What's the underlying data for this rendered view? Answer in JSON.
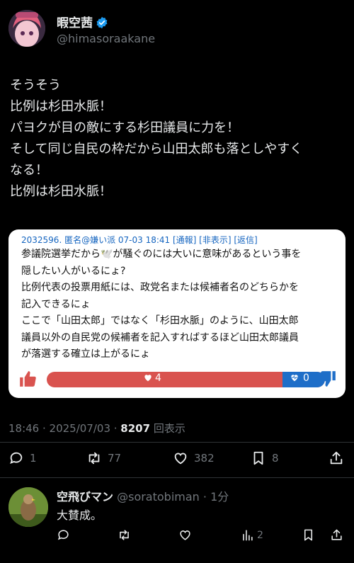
{
  "author": {
    "display_name": "暇空茜",
    "handle": "@himasoraakane"
  },
  "tweet": {
    "lines": [
      "そうそう",
      "比例は杉田水脈！",
      "パヨクが目の敵にする杉田議員に力を！",
      "そして同じ自民の枠だから山田太郎も落としやすく",
      "なる！",
      "比例は杉田水脈！"
    ]
  },
  "card": {
    "meta": "2032596. 匿名@嫌い派 07-03 18:41 [通報] [非表示] [返信]",
    "lines": [
      "参議院選挙だから🕊️が騒ぐのには大いに意味があるという事を",
      "隠したい人がいるにょ?",
      "比例代表の投票用紙には、政党名または候補者名のどちらかを",
      "記入できるにょ",
      "ここで「山田太郎」ではなく「杉田水脈」のように、山田太郎",
      "議員以外の自民党の候補者を記入すればするほど山田太郎議員",
      "が落選する確立は上がるにょ"
    ],
    "likes": "4",
    "dislikes": "0"
  },
  "timestamp": {
    "time": "18:46 · 2025/07/03 · ",
    "views_count": "8207",
    "views_label": " 回表示"
  },
  "actions": {
    "replies": "1",
    "retweets": "77",
    "likes": "382",
    "bookmarks": "8"
  },
  "reply": {
    "display_name": "空飛びマン",
    "handle_time": " @soratobiman · 1分",
    "text": "大賛成。",
    "views": "2"
  },
  "colors": {
    "accent": "#1d9bf0",
    "muted": "#71767b",
    "vote_red": "#d9534f",
    "vote_blue": "#1e6ec8",
    "card_link": "#1565c0"
  }
}
